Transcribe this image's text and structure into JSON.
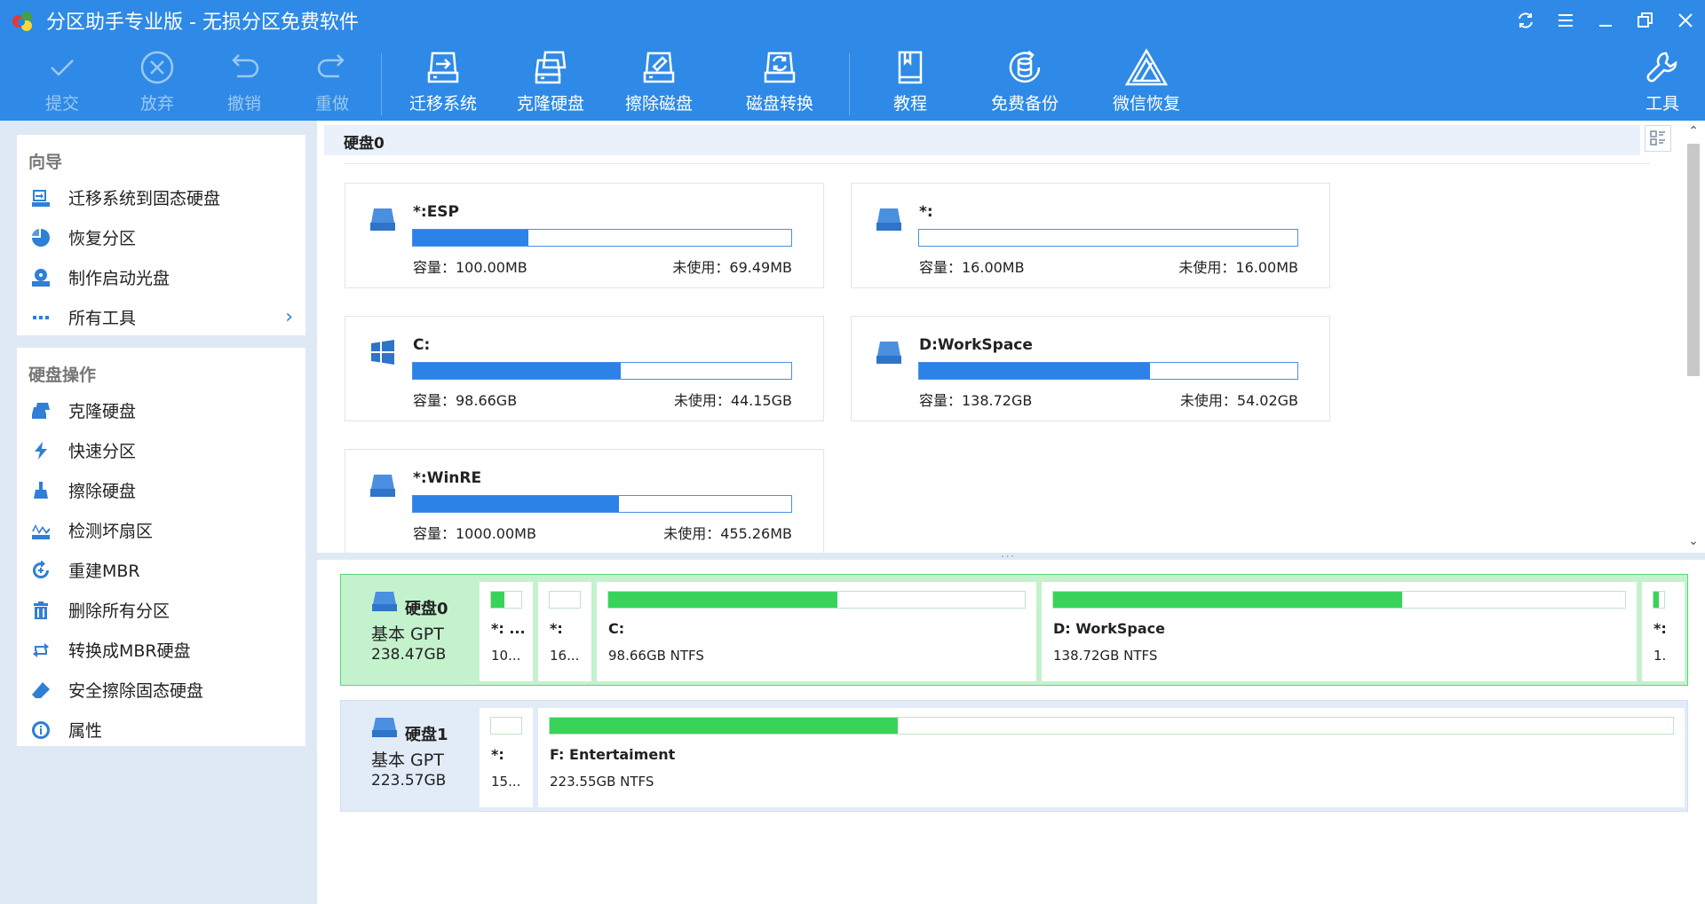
{
  "title": "分区助手专业版 - 无损分区免费软件",
  "toolbar": {
    "commit": "提交",
    "discard": "放弃",
    "undo": "撤销",
    "redo": "重做",
    "migrate": "迁移系统",
    "clone": "克隆硬盘",
    "wipe": "擦除磁盘",
    "convert": "磁盘转换",
    "tutorial": "教程",
    "backup": "免费备份",
    "wechat": "微信恢复",
    "tools": "工具"
  },
  "sidebar": {
    "wizard": {
      "title": "向导",
      "items": [
        {
          "label": "迁移系统到固态硬盘",
          "icon": "migrate-ssd-icon"
        },
        {
          "label": "恢复分区",
          "icon": "recover-partition-icon"
        },
        {
          "label": "制作启动光盘",
          "icon": "bootable-disc-icon"
        },
        {
          "label": "所有工具",
          "icon": "more-dots-icon"
        }
      ]
    },
    "disk_ops": {
      "title": "硬盘操作",
      "items": [
        {
          "label": "克隆硬盘",
          "icon": "clone-disk-icon"
        },
        {
          "label": "快速分区",
          "icon": "lightning-icon"
        },
        {
          "label": "擦除硬盘",
          "icon": "wipe-icon"
        },
        {
          "label": "检测坏扇区",
          "icon": "bad-sector-icon"
        },
        {
          "label": "重建MBR",
          "icon": "rebuild-mbr-icon"
        },
        {
          "label": "删除所有分区",
          "icon": "trash-icon"
        },
        {
          "label": "转换成MBR硬盘",
          "icon": "convert-icon"
        },
        {
          "label": "安全擦除固态硬盘",
          "icon": "eraser-icon"
        },
        {
          "label": "属性",
          "icon": "info-icon"
        }
      ]
    }
  },
  "disk0_header": "硬盘0",
  "partitions": [
    {
      "name": "*:ESP",
      "capacity": "容量：100.00MB",
      "free": "未使用：69.49MB",
      "used_fraction": 0.305,
      "icon": "drive-icon"
    },
    {
      "name": "*:",
      "capacity": "容量：16.00MB",
      "free": "未使用：16.00MB",
      "used_fraction": 0.0,
      "icon": "drive-icon"
    },
    {
      "name": "C:",
      "capacity": "容量：98.66GB",
      "free": "未使用：44.15GB",
      "used_fraction": 0.55,
      "icon": "windows-icon"
    },
    {
      "name": "D:WorkSpace",
      "capacity": "容量：138.72GB",
      "free": "未使用：54.02GB",
      "used_fraction": 0.61,
      "icon": "drive-icon"
    },
    {
      "name": "*:WinRE",
      "capacity": "容量：1000.00MB",
      "free": "未使用：455.26MB",
      "used_fraction": 0.545,
      "icon": "drive-icon"
    }
  ],
  "disks": [
    {
      "name": "硬盘0",
      "type": "基本 GPT",
      "size": "238.47GB",
      "blocks": [
        {
          "name": "*: ...",
          "info": "10...",
          "used_fraction": 0.45
        },
        {
          "name": "*:",
          "info": "16...",
          "used_fraction": 0.0
        },
        {
          "name": "C:",
          "info": "98.66GB NTFS",
          "used_fraction": 0.55
        },
        {
          "name": "D: WorkSpace",
          "info": "138.72GB NTFS",
          "used_fraction": 0.61
        },
        {
          "name": "*:",
          "info": "1.",
          "used_fraction": 0.5
        }
      ]
    },
    {
      "name": "硬盘1",
      "type": "基本 GPT",
      "size": "223.57GB",
      "blocks": [
        {
          "name": "*:",
          "info": "15...",
          "used_fraction": 0.0
        },
        {
          "name": "F: Entertaiment",
          "info": "223.55GB NTFS",
          "used_fraction": 0.31
        }
      ]
    }
  ],
  "colors": {
    "accent": "#2e8ae6",
    "partition_bar": "#2d82e8",
    "block_bar": "#38d459",
    "selected_disk": "#c4f2cd",
    "sidebar_bg": "#dfe9f6"
  }
}
